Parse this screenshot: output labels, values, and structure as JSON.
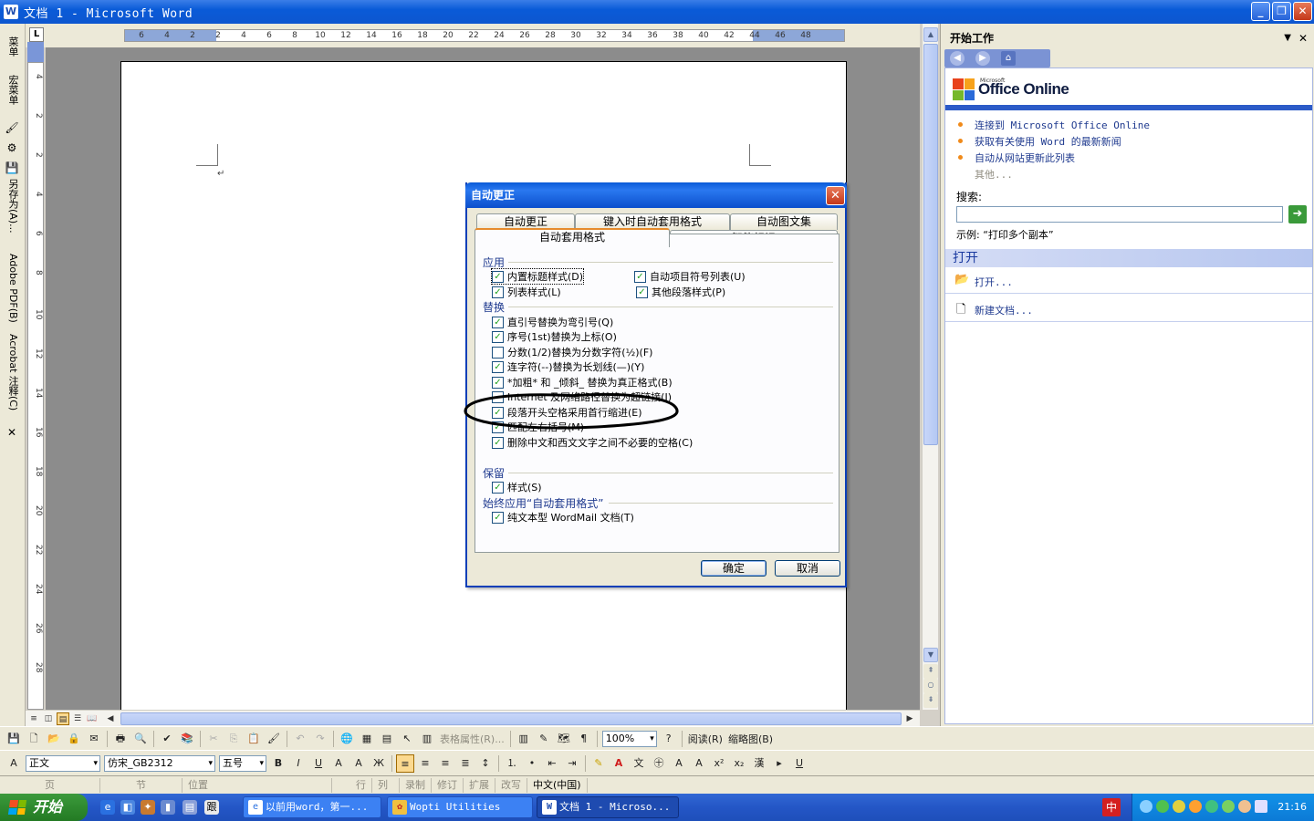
{
  "window": {
    "title": "文档 1 - Microsoft Word"
  },
  "left_toolbar": {
    "items": [
      "菜单",
      "宏菜单",
      "另存为(A)...",
      "Adobe PDF(B)",
      "Acrobat 注释(C)"
    ]
  },
  "ruler": {
    "h_ticks": [
      "6",
      "4",
      "2",
      "2",
      "4",
      "6",
      "8",
      "10",
      "12",
      "14",
      "16",
      "18",
      "20",
      "22",
      "24",
      "26",
      "28",
      "30",
      "32",
      "34",
      "36",
      "38",
      "40",
      "42",
      "44",
      "46",
      "48"
    ],
    "v_ticks": [
      "4",
      "2",
      "2",
      "4",
      "6",
      "8",
      "10",
      "12",
      "14",
      "16",
      "18",
      "20",
      "22",
      "24",
      "26",
      "28"
    ]
  },
  "task_pane": {
    "title": "开始工作",
    "logo_small": "Microsoft",
    "logo_text": "Office Online",
    "links": [
      "连接到 Microsoft Office Online",
      "获取有关使用 Word 的最新新闻",
      "自动从网站更新此列表"
    ],
    "more": "其他...",
    "search_label": "搜索:",
    "example": "示例:  “打印多个副本”",
    "open_section": "打开",
    "open_link": "打开...",
    "new_doc_link": "新建文档..."
  },
  "dialog": {
    "title": "自动更正",
    "tabs_back": [
      "自动更正",
      "键入时自动套用格式",
      "自动图文集"
    ],
    "tabs_front": [
      "自动套用格式",
      "智能标记"
    ],
    "group_apply": "应用",
    "apply_items": [
      {
        "label": "内置标题样式(D)",
        "checked": true
      },
      {
        "label": "自动项目符号列表(U)",
        "checked": true
      },
      {
        "label": "列表样式(L)",
        "checked": true
      },
      {
        "label": "其他段落样式(P)",
        "checked": true
      }
    ],
    "group_replace": "替换",
    "replace_items": [
      {
        "label": "直引号替换为弯引号(Q)",
        "checked": true
      },
      {
        "label": "序号(1st)替换为上标(O)",
        "checked": true
      },
      {
        "label": "分数(1/2)替换为分数字符(½)(F)",
        "checked": false
      },
      {
        "label": "连字符(--)替换为长划线(—)(Y)",
        "checked": true
      },
      {
        "label": "*加粗* 和 _倾斜_ 替换为真正格式(B)",
        "checked": true
      },
      {
        "label": "Internet 及网络路径替换为超链接(I)",
        "checked": false
      },
      {
        "label": "段落开头空格采用首行缩进(E)",
        "checked": true
      },
      {
        "label": "匹配左右括号(M)",
        "checked": true
      },
      {
        "label": "删除中文和西文文字之间不必要的空格(C)",
        "checked": true
      }
    ],
    "group_preserve": "保留",
    "preserve_items": [
      {
        "label": "样式(S)",
        "checked": true
      }
    ],
    "group_always": "始终应用“自动套用格式”",
    "always_items": [
      {
        "label": "纯文本型 WordMail 文档(T)",
        "checked": true
      }
    ],
    "ok": "确定",
    "cancel": "取消"
  },
  "toolbar1": {
    "table_props": "表格属性(R)...",
    "zoom": "100%",
    "read": "阅读(R)",
    "thumbnails": "缩略图(B)"
  },
  "toolbar2": {
    "style": "正文",
    "font": "仿宋_GB2312",
    "size": "五号"
  },
  "statusbar": {
    "cells": [
      "页",
      "节",
      "位置",
      "行",
      "列",
      "录制",
      "修订",
      "扩展",
      "改写",
      "中文(中国)"
    ]
  },
  "taskbar": {
    "start": "开始",
    "tasks": [
      "以前用word，第一...",
      "Wopti Utilities",
      "文档 1 - Microso..."
    ],
    "clock": "21:16"
  },
  "colors": {
    "title_blue": "#0a5bd8",
    "accent_orange": "#e68b2c",
    "link_blue": "#1f3a8f",
    "check_green": "#21a121"
  }
}
